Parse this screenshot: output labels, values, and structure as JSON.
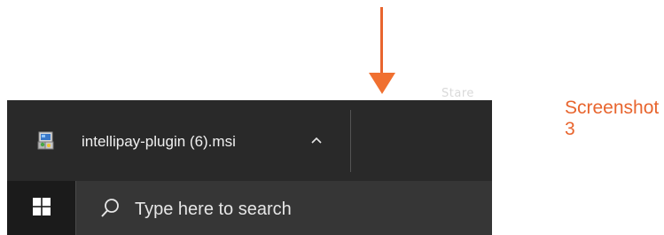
{
  "annotation": {
    "label": "Screenshot 3",
    "faint_text": "Stare",
    "arrow_color": "#E8652E"
  },
  "download_bar": {
    "file_name": "intellipay-plugin (6).msi",
    "file_icon": "msi-installer-icon",
    "expand_icon": "chevron-up-icon",
    "background": "#292929"
  },
  "taskbar": {
    "start_icon": "windows-logo-icon",
    "search_icon": "search-icon",
    "search_placeholder": "Type here to search",
    "background": "#1b1b1b",
    "search_background": "#363636"
  }
}
